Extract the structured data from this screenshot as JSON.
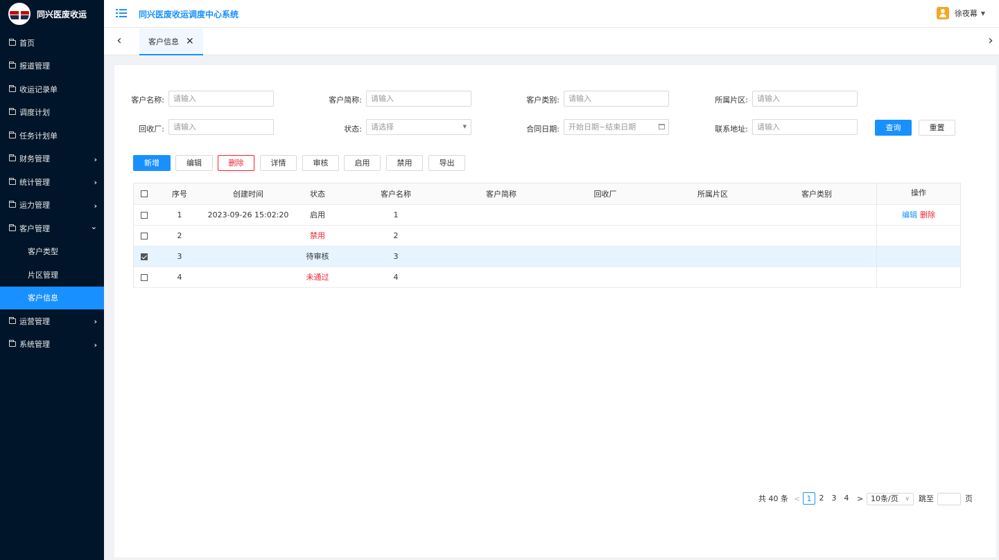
{
  "brand": {
    "name": "同兴医废收运"
  },
  "header": {
    "system_title": "同兴医废收运调度中心系统",
    "user_name": "徐夜幕",
    "user_caret": "▼"
  },
  "sidebar": {
    "items": [
      {
        "label": "首页"
      },
      {
        "label": "报道管理"
      },
      {
        "label": "收运记录单"
      },
      {
        "label": "调度计划"
      },
      {
        "label": "任务计划单"
      },
      {
        "label": "财务管理",
        "chevron": "›"
      },
      {
        "label": "统计管理",
        "chevron": "›"
      },
      {
        "label": "运力管理",
        "chevron": "›"
      },
      {
        "label": "客户管理",
        "chevron": "⌄"
      },
      {
        "label": "客户类型"
      },
      {
        "label": "片区管理"
      },
      {
        "label": "客户信息"
      },
      {
        "label": "运营管理",
        "chevron": "›"
      },
      {
        "label": "系统管理",
        "chevron": "›"
      }
    ]
  },
  "tabs": {
    "prev": "‹",
    "next": "›",
    "active_label": "客户信息",
    "close": "✕"
  },
  "search_form": {
    "customer_name": {
      "label": "客户名称:",
      "placeholder": "请输入"
    },
    "customer_short": {
      "label": "客户简称:",
      "placeholder": "请输入"
    },
    "customer_type": {
      "label": "客户类别:",
      "placeholder": "请输入"
    },
    "district": {
      "label": "所属片区:",
      "placeholder": "请输入"
    },
    "recycler": {
      "label": "回收厂:",
      "placeholder": "请输入"
    },
    "status": {
      "label": "状态:",
      "placeholder": "请选择",
      "caret": "▼"
    },
    "contract_date": {
      "label": "合同日期:",
      "placeholder": "开始日期~结束日期"
    },
    "address": {
      "label": "联系地址:",
      "placeholder": "请输入"
    },
    "query_button": "查询",
    "reset_button": "重置"
  },
  "toolbar": {
    "add": "新增",
    "edit": "编辑",
    "delete": "删除",
    "detail": "详情",
    "audit": "审核",
    "enable": "启用",
    "disable": "禁用",
    "export": "导出"
  },
  "table": {
    "columns": {
      "index": "序号",
      "created_at": "创建时间",
      "status": "状态",
      "customer_name": "客户名称",
      "customer_short": "客户简称",
      "recycler": "回收厂",
      "district": "所属片区",
      "customer_type": "客户类别",
      "actions": "操作"
    },
    "rows": [
      {
        "index": "1",
        "created_at": "2023-09-26 15:02:20",
        "status": "启用",
        "customer_name": "1",
        "checked": false,
        "action_edit": "编辑",
        "action_delete": "删除"
      },
      {
        "index": "2",
        "created_at": "",
        "status": "禁用",
        "customer_name": "2",
        "checked": false
      },
      {
        "index": "3",
        "created_at": "",
        "status": "待审核",
        "customer_name": "3",
        "checked": true
      },
      {
        "index": "4",
        "created_at": "",
        "status": "未通过",
        "customer_name": "4",
        "checked": false
      }
    ]
  },
  "pagination": {
    "total": "共 40 条",
    "prev": "<",
    "next": ">",
    "pages": [
      "1",
      "2",
      "3",
      "4"
    ],
    "current_page": "1",
    "page_size": "10条/页",
    "page_size_caret": "∨",
    "jump_label": "跳至",
    "page_suffix": "页"
  },
  "colors": {
    "sidebar_bg": "#001529",
    "primary": "#1890ff",
    "danger": "#f5222d",
    "selected_row": "#e6f4ff"
  }
}
